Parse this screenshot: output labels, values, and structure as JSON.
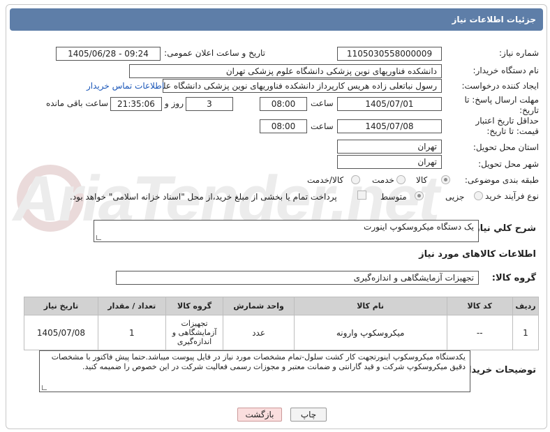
{
  "header": {
    "title": "جزئیات اطلاعات نیاز"
  },
  "fields": {
    "need_number_label": "شماره نیاز:",
    "need_number": "1105030558000009",
    "announce_label": "تاریخ و ساعت اعلان عمومی:",
    "announce_value": "1405/06/28 - 09:24",
    "buyer_org_label": "نام دستگاه خریدار:",
    "buyer_org": "دانشکده فناوریهای نوین پزشکی دانشگاه علوم پزشکی تهران",
    "requester_label": "ایجاد کننده درخواست:",
    "requester": "رسول  نباتعلی زاده هریس کارپرداز دانشکده فناوریهای نوین پزشکی دانشگاه علوم",
    "contact_link": "اطلاعات تماس خریدار",
    "deadline_label": "مهلت ارسال پاسخ: تا تاریخ:",
    "deadline_date": "1405/07/01",
    "time_label": "ساعت",
    "deadline_time": "08:00",
    "days_value": "3",
    "days_label": "روز و",
    "remaining_time": "21:35:06",
    "remaining_label": "ساعت باقی مانده",
    "price_validity_label": "حداقل تاریخ اعتبار قیمت: تا تاریخ:",
    "price_date": "1405/07/08",
    "price_time": "08:00",
    "province_label": "استان محل تحویل:",
    "province": "تهران",
    "city_label": "شهر محل تحویل:",
    "city": "تهران",
    "category_label": "طبقه بندی موضوعی:",
    "category_options": [
      "کالا",
      "خدمت",
      "کالا/خدمت"
    ],
    "process_label": "نوع فرآیند خرید :",
    "process_options": [
      "جزیی",
      "متوسط"
    ],
    "payment_text": "پرداخت تمام یا بخشی از مبلغ خرید،از محل \"اسناد خزانه اسلامی\" خواهد بود."
  },
  "description": {
    "label": "شرح كلي نياز:",
    "value": "یک دستگاه میکروسکوپ اینورت"
  },
  "goods": {
    "section_title": "اطلاعات کالاهای مورد نیاز",
    "group_label": "گروه کالا:",
    "group_value": "تجهیزات آزمایشگاهی و اندازه‌گیری",
    "columns": [
      "ردیف",
      "کد کالا",
      "نام کالا",
      "واحد شمارش",
      "گروه کالا",
      "تعداد / مقدار",
      "تاریخ نیاز"
    ],
    "rows": [
      {
        "index": "1",
        "code": "--",
        "name": "میکروسکوپ وارونه",
        "unit": "عدد",
        "group": "تجهیزات آزمایشگاهی و اندازه‌گیری",
        "qty": "1",
        "date": "1405/07/08"
      }
    ]
  },
  "buyer_notes": {
    "label": "توضیحات خریدار:",
    "value": "یکدستگاه میکروسکوپ اینورتجهت کار کشت سلول-تمام مشخصات مورد نیاز در فایل پیوست میباشد.حتما پیش فاکتور با مشخصات دقیق میکروسکوپ شرکت و  قید گارانتی و ضمانت معتبر و مجوزات رسمی فعالیت شرکت در این خصوص را ضمیمه کنید."
  },
  "buttons": {
    "print": "چاپ",
    "back": "بازگشت"
  },
  "watermark": "AriaTender.net"
}
